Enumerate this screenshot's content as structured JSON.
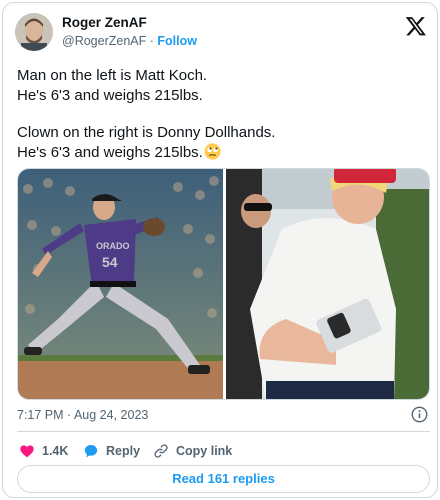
{
  "tweet": {
    "author_name": "Roger ZenAF",
    "author_handle": "@RogerZenAF",
    "separator": "·",
    "follow_label": "Follow",
    "lines": [
      "Man on the left is Matt Koch.",
      "He's 6'3 and weighs 215lbs.",
      "Clown on the right is Donny Dollhands.",
      "He's 6'3 and weighs 215lbs."
    ],
    "emoji": "face-with-rolling-eyes",
    "timestamp": "7:17 PM · Aug 24, 2023"
  },
  "media": {
    "left_jersey_text": "ORADO",
    "left_jersey_number": "54"
  },
  "actions": {
    "like_count": "1.4K",
    "reply_label": "Reply",
    "copy_link_label": "Copy link"
  },
  "footer": {
    "read_replies_label": "Read 161 replies"
  },
  "icons": [
    "avatar",
    "x-logo-icon",
    "info-icon",
    "heart-icon",
    "reply-bubble-icon",
    "link-icon",
    "rolling-eyes-emoji-icon"
  ],
  "colors": {
    "accent": "#1d9bf0",
    "like": "#f91880",
    "text_primary": "#0f1419",
    "text_secondary": "#536471",
    "border": "#cfd9de"
  }
}
